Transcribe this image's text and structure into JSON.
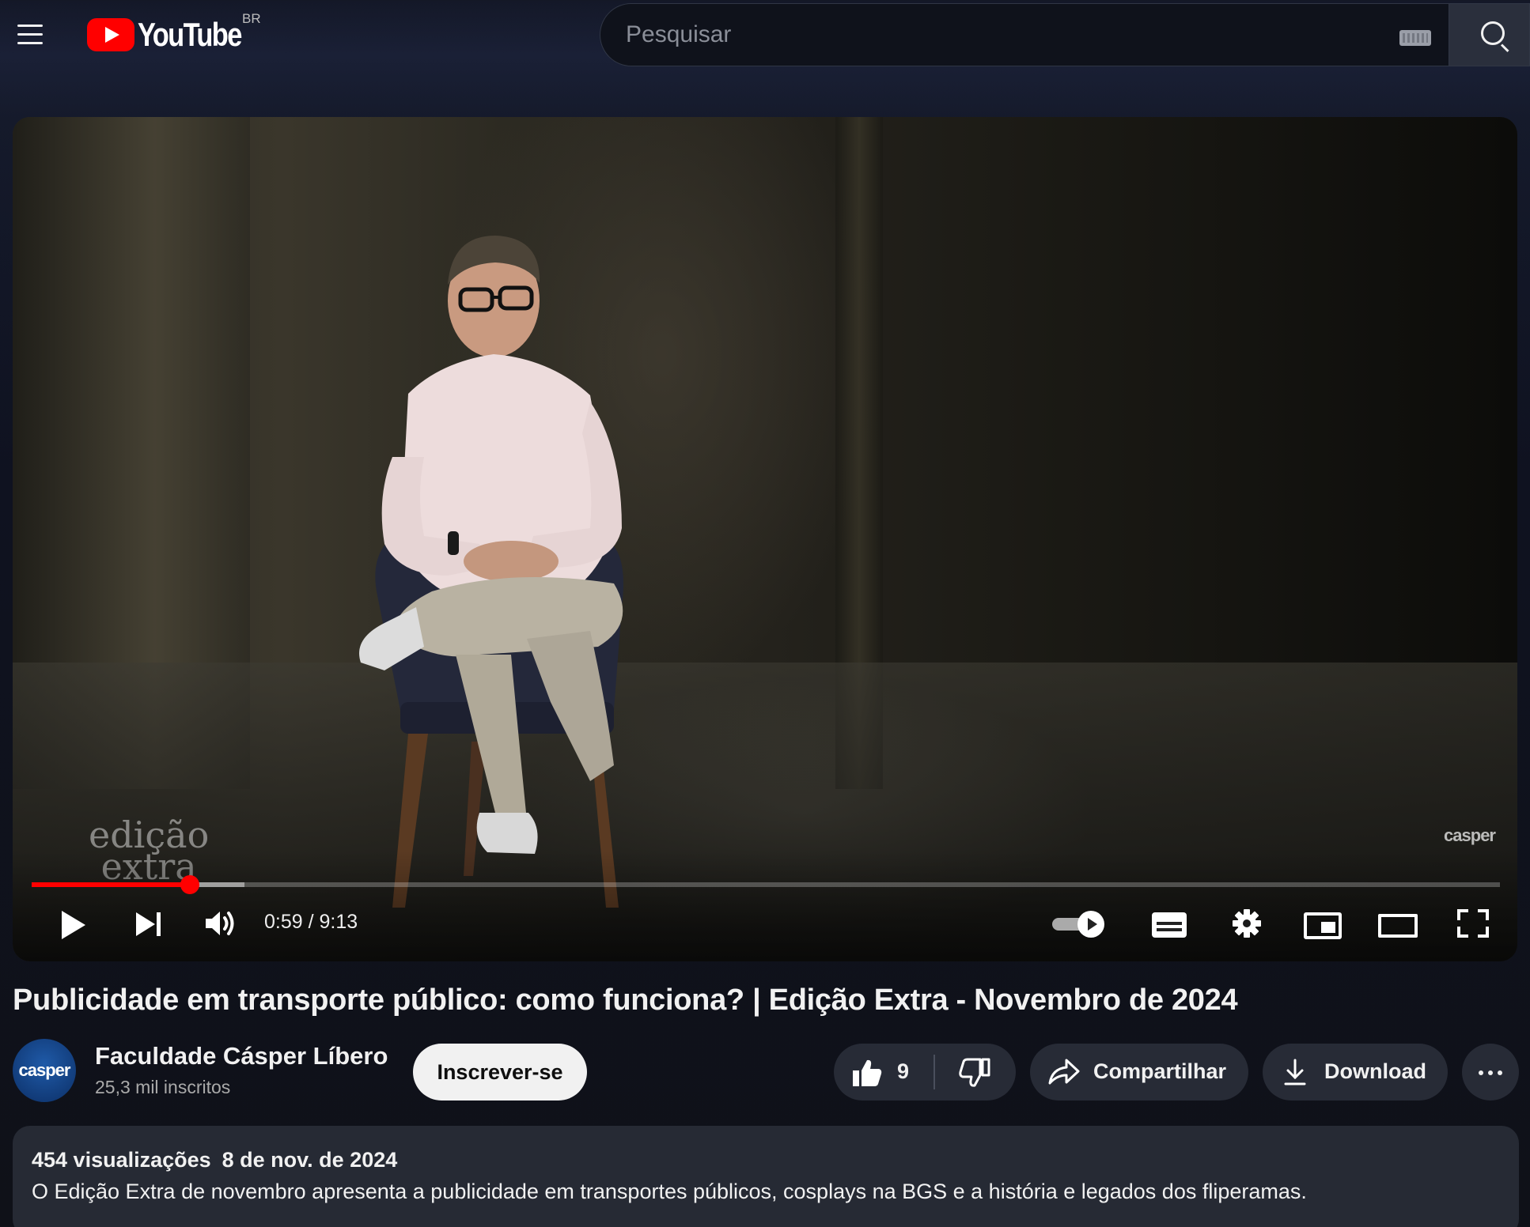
{
  "header": {
    "logo_text": "YouTube",
    "region": "BR",
    "search_placeholder": "Pesquisar"
  },
  "player": {
    "time_current": "0:59",
    "time_total": "9:13",
    "time_display": "0:59 / 9:13",
    "progress_fraction": 0.1078,
    "buffer_fraction": 0.145,
    "watermark_left": "edição extra",
    "watermark_right": "casper",
    "autoplay_on": true
  },
  "video": {
    "title": "Publicidade em transporte público: como funciona? | Edição Extra - Novembro de 2024"
  },
  "channel": {
    "avatar_text": "casper",
    "name": "Faculdade Cásper Líbero",
    "subscribers": "25,3 mil inscritos",
    "subscribe_label": "Inscrever-se"
  },
  "actions": {
    "likes": "9",
    "share_label": "Compartilhar",
    "download_label": "Download"
  },
  "description": {
    "views": "454 visualizações",
    "date": "8 de nov. de 2024",
    "text": "O Edição Extra de novembro apresenta a publicidade em transportes públicos, cosplays na BGS e a história e legados dos fliperamas."
  },
  "colors": {
    "brand_red": "#ff0000",
    "background": "#0f1118",
    "pill": "#272b36"
  }
}
